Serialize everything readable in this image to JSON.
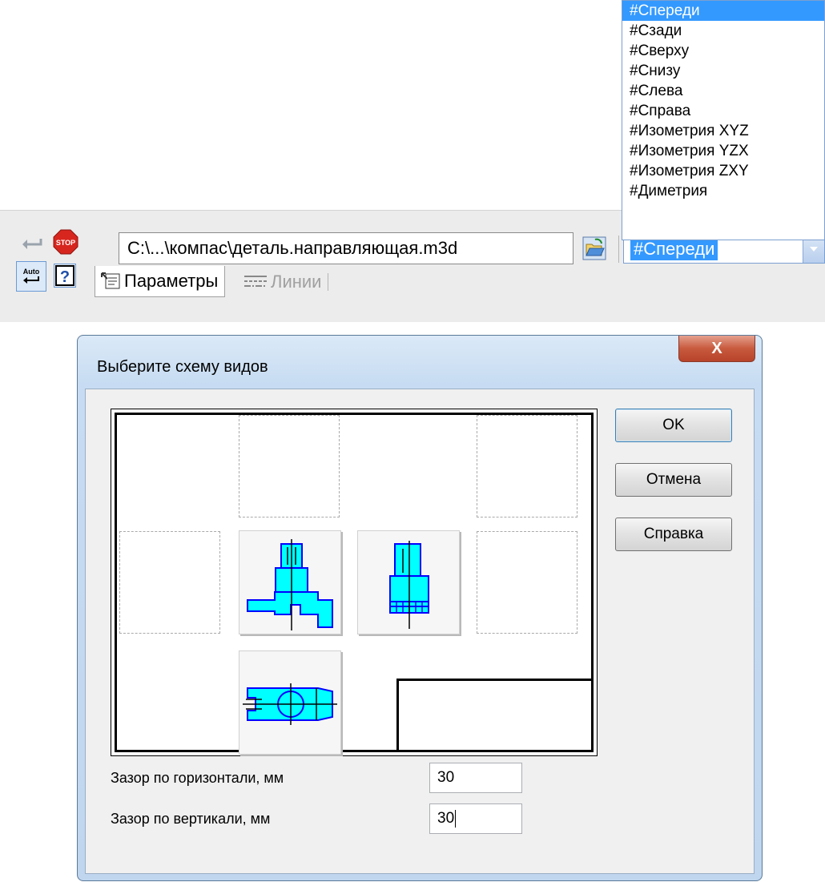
{
  "toolbar": {
    "file_path": "C:\\...\\компас\\деталь.направляющая.m3d",
    "orientation_selected": "#Спереди",
    "tabs": [
      {
        "label": "Параметры"
      },
      {
        "label": "Линии"
      }
    ],
    "icons": {
      "apply": "enter-arrow-icon",
      "stop": "stop-icon",
      "auto": "auto-create-icon",
      "help": "help-icon",
      "open": "open-file-icon"
    },
    "auto_label": "Auto",
    "stop_label": "STOP"
  },
  "dropdown": {
    "items": [
      "#Спереди",
      "#Сзади",
      "#Сверху",
      "#Снизу",
      "#Слева",
      "#Справа",
      "#Изометрия XYZ",
      "#Изометрия YZX",
      "#Изометрия ZXY",
      "#Диметрия"
    ],
    "selected_index": 0
  },
  "dialog": {
    "title": "Выберите схему видов",
    "close_label": "X",
    "buttons": {
      "ok": "OK",
      "cancel": "Отмена",
      "help": "Справка"
    },
    "fields": {
      "horizontal_gap_label": "Зазор по горизонтали, мм",
      "horizontal_gap_value": "30",
      "vertical_gap_label": "Зазор по вертикали, мм",
      "vertical_gap_value": "30"
    }
  },
  "colors": {
    "selection": "#3399ff",
    "part_fill": "#00ffff",
    "part_stroke": "#0000ff",
    "dialog_frame": "#c7dcf2",
    "close_button": "#c85a3e"
  }
}
